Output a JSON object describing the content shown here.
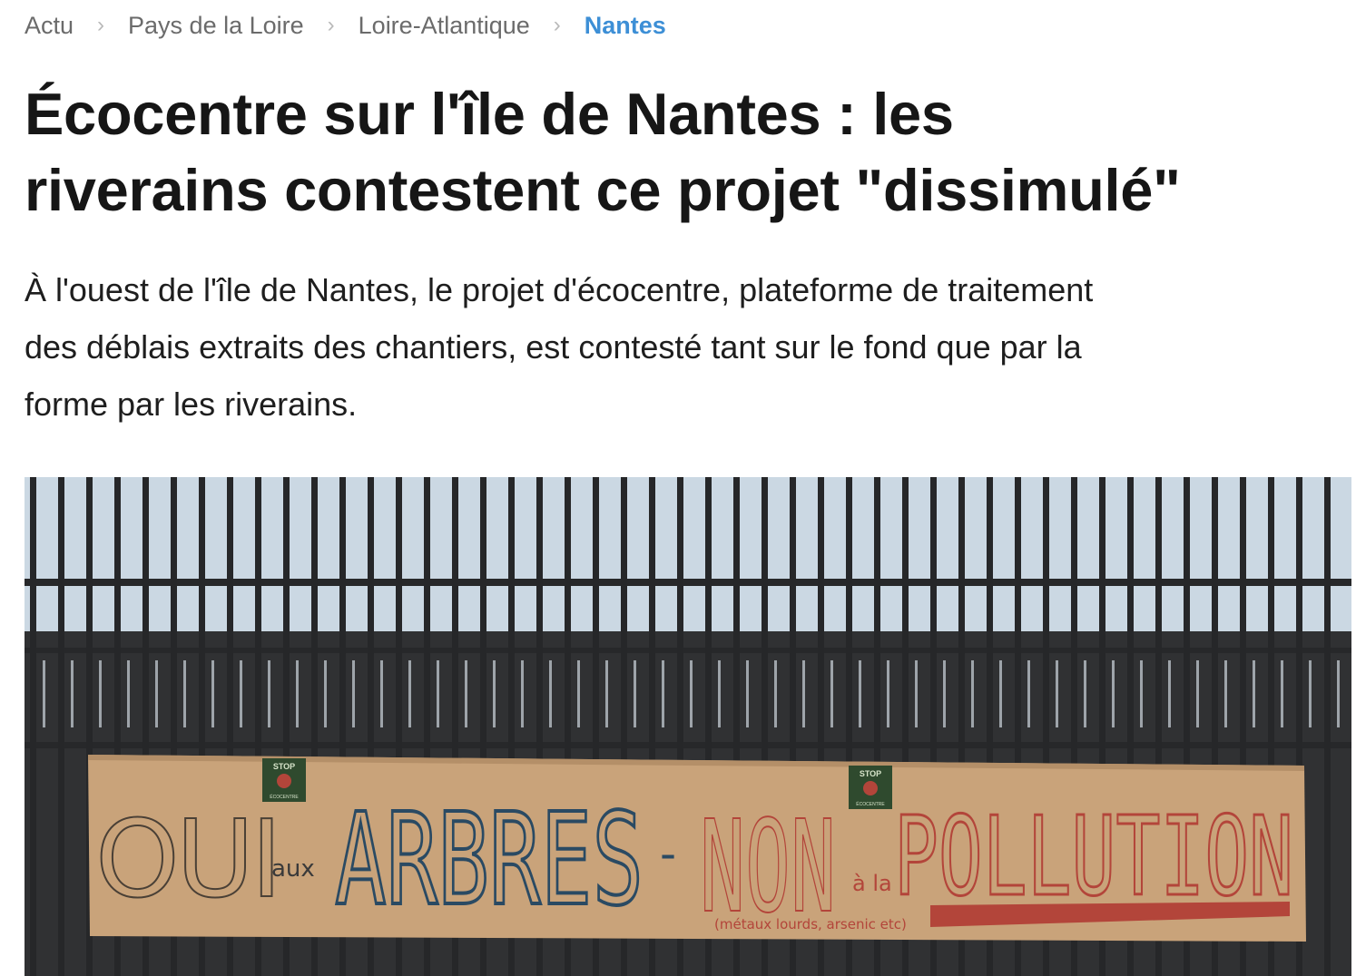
{
  "breadcrumb": {
    "items": [
      "Actu",
      "Pays de la Loire",
      "Loire-Atlantique",
      "Nantes"
    ],
    "separator": "›",
    "active_color": "#3d8fd6"
  },
  "article": {
    "title_line1": "Écocentre sur l'île de Nantes : les",
    "title_line2": "riverains contestent ce projet \"dissimulé\"",
    "lede_line1": "À l'ouest de l'île de Nantes, le projet d'écocentre, plateforme de traitement",
    "lede_line2": "des déblais extraits des chantiers, est contesté tant sur le fond que par la",
    "lede_line3": "forme par les riverains."
  },
  "photo": {
    "banner": {
      "word1": "OUI",
      "word2": "aux",
      "word3": "ARBRES",
      "dash": "-",
      "word4": "NON",
      "word5": "à la",
      "word6": "POLLUTION",
      "note": "(métaux lourds, arsenic etc)"
    },
    "sticker": {
      "top": "STOP",
      "bottom": "ÉCOCENTRE"
    },
    "colors": {
      "sky": "#cbd8e3",
      "fence": "#2b2c2e",
      "cardboard": "#c9a37a",
      "blue_ink": "#2a4a63",
      "red_ink": "#b3453a",
      "black_ink": "#3a3a3a"
    }
  }
}
